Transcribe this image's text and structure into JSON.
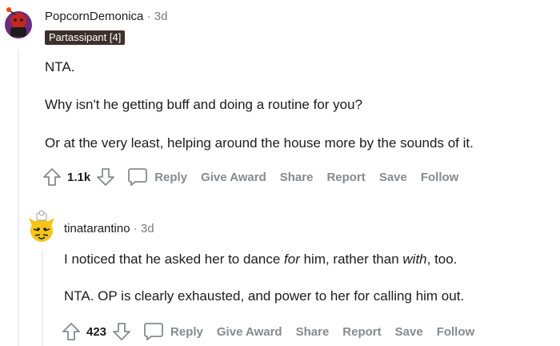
{
  "comment1": {
    "username": "PopcornDemonica",
    "dot": "·",
    "timestamp": "3d",
    "flair": "Partassipant [4]",
    "paragraphs": [
      "NTA.",
      "Why isn't he getting buff and doing a routine for you?",
      "Or at the very least, helping around the house more by the sounds of it."
    ],
    "score": "1.1k",
    "actions": {
      "reply": "Reply",
      "give_award": "Give Award",
      "share": "Share",
      "report": "Report",
      "save": "Save",
      "follow": "Follow"
    }
  },
  "comment2": {
    "username": "tinatarantino",
    "dot": "·",
    "timestamp": "3d",
    "p1": {
      "a": "I noticed that he asked her to dance ",
      "b": "for",
      "c": " him, rather than ",
      "d": "with",
      "e": ", too."
    },
    "p2": "NTA. OP is clearly exhausted, and power to her for calling him out.",
    "score": "423",
    "actions": {
      "reply": "Reply",
      "give_award": "Give Award",
      "share": "Share",
      "report": "Report",
      "save": "Save",
      "follow": "Follow"
    }
  },
  "icons": {
    "upvote": "upvote-arrow-icon",
    "downvote": "downvote-arrow-icon",
    "reply": "speech-bubble-icon"
  },
  "colors": {
    "flair_bg": "#3d302c",
    "action_gray": "#878a8c",
    "meta_gray": "#7c7c7c"
  }
}
